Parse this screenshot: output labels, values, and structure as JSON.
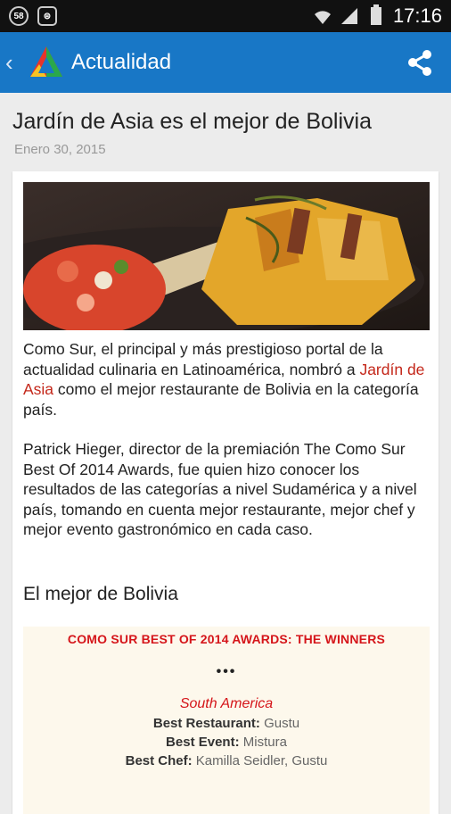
{
  "statusbar": {
    "notif1": "58",
    "notif2": "⊜",
    "time": "17:16"
  },
  "appbar": {
    "back_icon": "‹",
    "title": "Actualidad"
  },
  "article": {
    "title": "Jardín de Asia es el mejor de Bolivia",
    "date": "Enero 30, 2015",
    "p1_before": "Como Sur, el principal y más prestigioso portal de la actualidad culinaria en Latinoamérica, nombró a ",
    "p1_link": "Jardín de Asia",
    "p1_after": " como el mejor restaurante de Bolivia en la categoría país.",
    "p2": "Patrick Hieger, director de la premiación The Como Sur Best Of 2014 Awards, fue quien hizo conocer los resultados de las categorías a nivel Sudamérica y a nivel país, tomando en cuenta mejor restaurante, mejor chef y mejor evento gastronómico en cada caso.",
    "subhead": "El mejor de Bolivia"
  },
  "awards": {
    "heading": "COMO SUR BEST OF 2014 AWARDS: THE WINNERS",
    "dots": "•••",
    "region": "South America",
    "rows": [
      {
        "label": "Best Restaurant:",
        "value": "Gustu"
      },
      {
        "label": "Best Event:",
        "value": "Mistura"
      },
      {
        "label": "Best Chef:",
        "value": "Kamilla Seidler, Gustu"
      }
    ]
  }
}
